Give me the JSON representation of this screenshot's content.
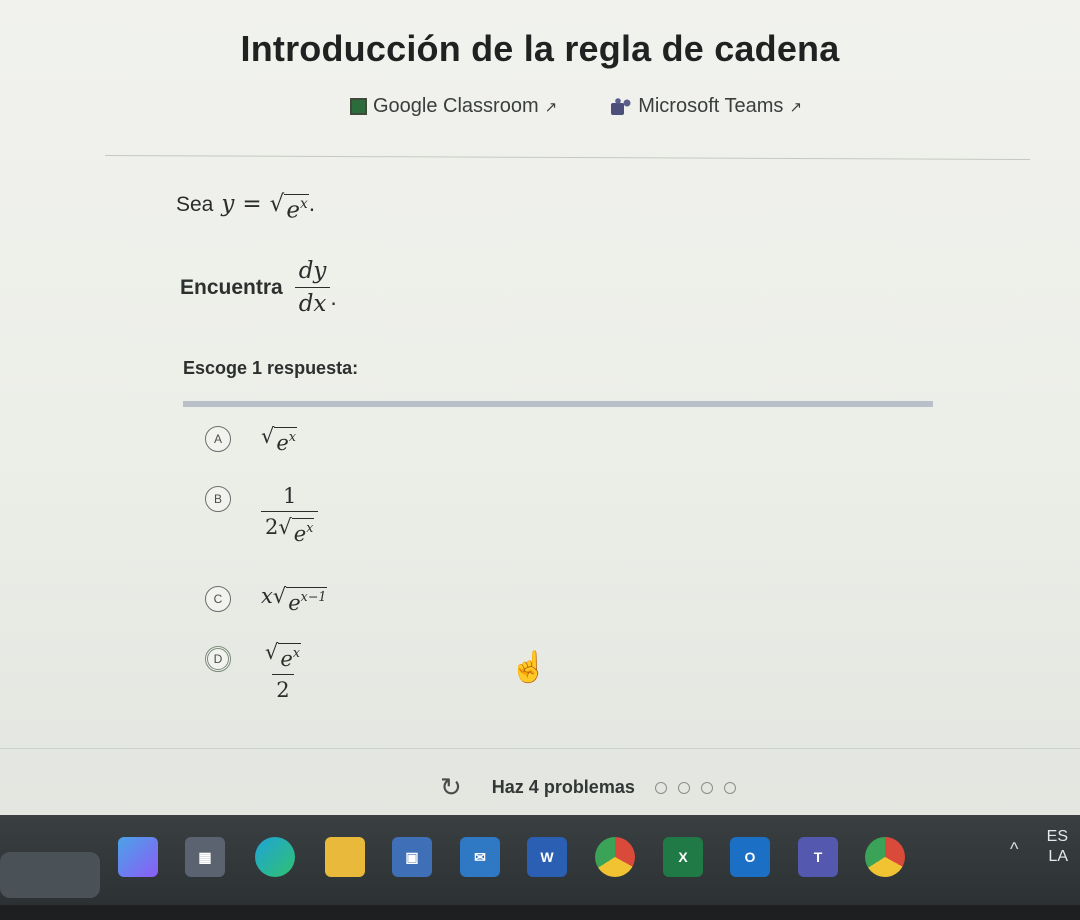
{
  "page": {
    "title": "Introducción de la regla de cadena",
    "share": {
      "google_classroom": "Google Classroom",
      "microsoft_teams": "Microsoft Teams",
      "external_link_icon": "external-link-icon"
    }
  },
  "question": {
    "line1_lead": "Sea",
    "line1_var": "y",
    "line1_eq": "=",
    "line1_base": "e",
    "line1_exp": "x",
    "line1_end": ".",
    "line2_lead": "Encuentra",
    "line2_num": "dy",
    "line2_den": "dx",
    "line2_end": "."
  },
  "answers": {
    "prompt": "Escoge 1 respuesta:",
    "options": [
      {
        "letter": "A",
        "base": "e",
        "exp": "x"
      },
      {
        "letter": "B",
        "num": "1",
        "den_coef": "2",
        "base": "e",
        "exp": "x"
      },
      {
        "letter": "C",
        "coef": "x",
        "base": "e",
        "exp": "x−1"
      },
      {
        "letter": "D",
        "base": "e",
        "exp": "x",
        "den": "2",
        "selected": true
      }
    ]
  },
  "footer": {
    "progress_text": "Haz 4 problemas",
    "total_problems": 4,
    "completed": 0
  },
  "taskbar": {
    "tray_line1": "ES",
    "tray_line2": "LA",
    "apps": [
      "copilot-icon",
      "calculator-icon",
      "edge-icon",
      "file-explorer-icon",
      "store-icon",
      "mail-icon",
      "word-icon",
      "chrome-icon",
      "excel-icon",
      "outlook-icon",
      "teams-icon",
      "chrome-profile-icon"
    ],
    "word_label": "W",
    "excel_label": "X",
    "outlook_label": "O",
    "teams_label": "T"
  },
  "colors": {
    "background": "#eceee8",
    "choice_bar": "#b9c0c8",
    "taskbar": "#33393b"
  }
}
